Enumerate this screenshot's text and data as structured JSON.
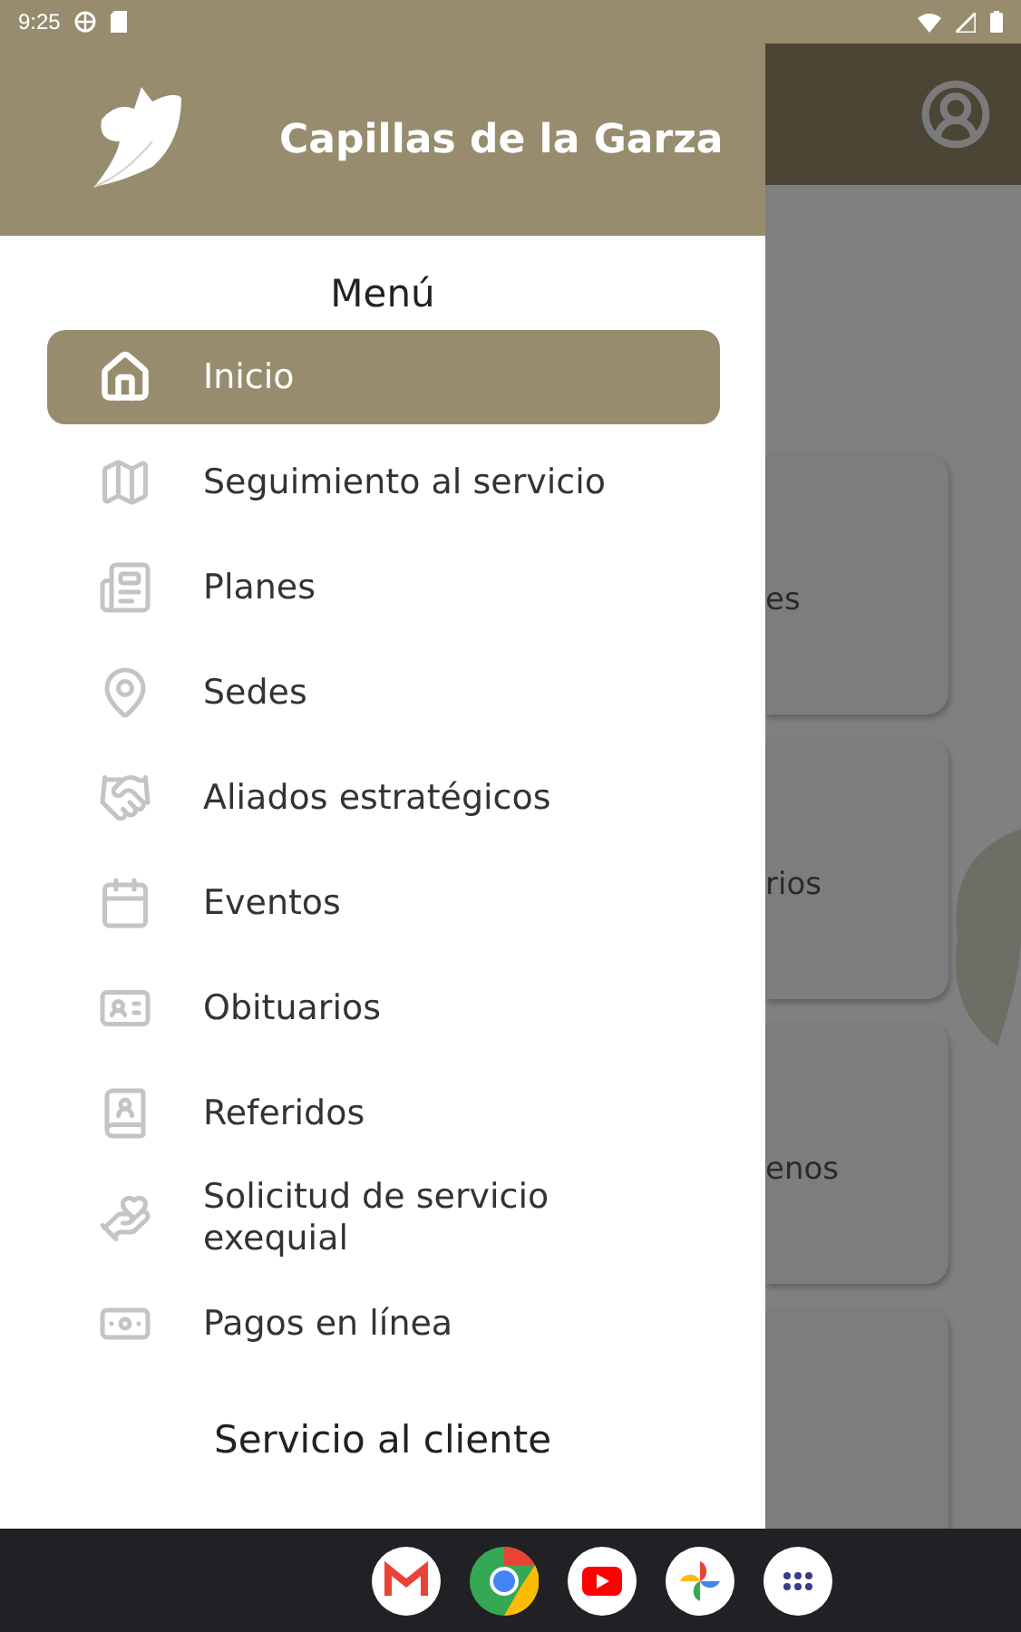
{
  "status_bar": {
    "time": "9:25"
  },
  "drawer": {
    "title": "Capillas de la Garza",
    "menu_heading": "Menú",
    "items": [
      {
        "label": "Inicio",
        "selected": true
      },
      {
        "label": "Seguimiento al servicio",
        "selected": false
      },
      {
        "label": "Planes",
        "selected": false
      },
      {
        "label": "Sedes",
        "selected": false
      },
      {
        "label": "Aliados estratégicos",
        "selected": false
      },
      {
        "label": "Eventos",
        "selected": false
      },
      {
        "label": "Obituarios",
        "selected": false
      },
      {
        "label": "Referidos",
        "selected": false
      },
      {
        "label": "Solicitud de servicio exequial",
        "selected": false
      },
      {
        "label": "Pagos en línea",
        "selected": false
      }
    ],
    "section_heading": "Servicio al cliente"
  },
  "background": {
    "cards": [
      {
        "label": "es"
      },
      {
        "label": "rios"
      },
      {
        "label": "enos"
      }
    ]
  }
}
